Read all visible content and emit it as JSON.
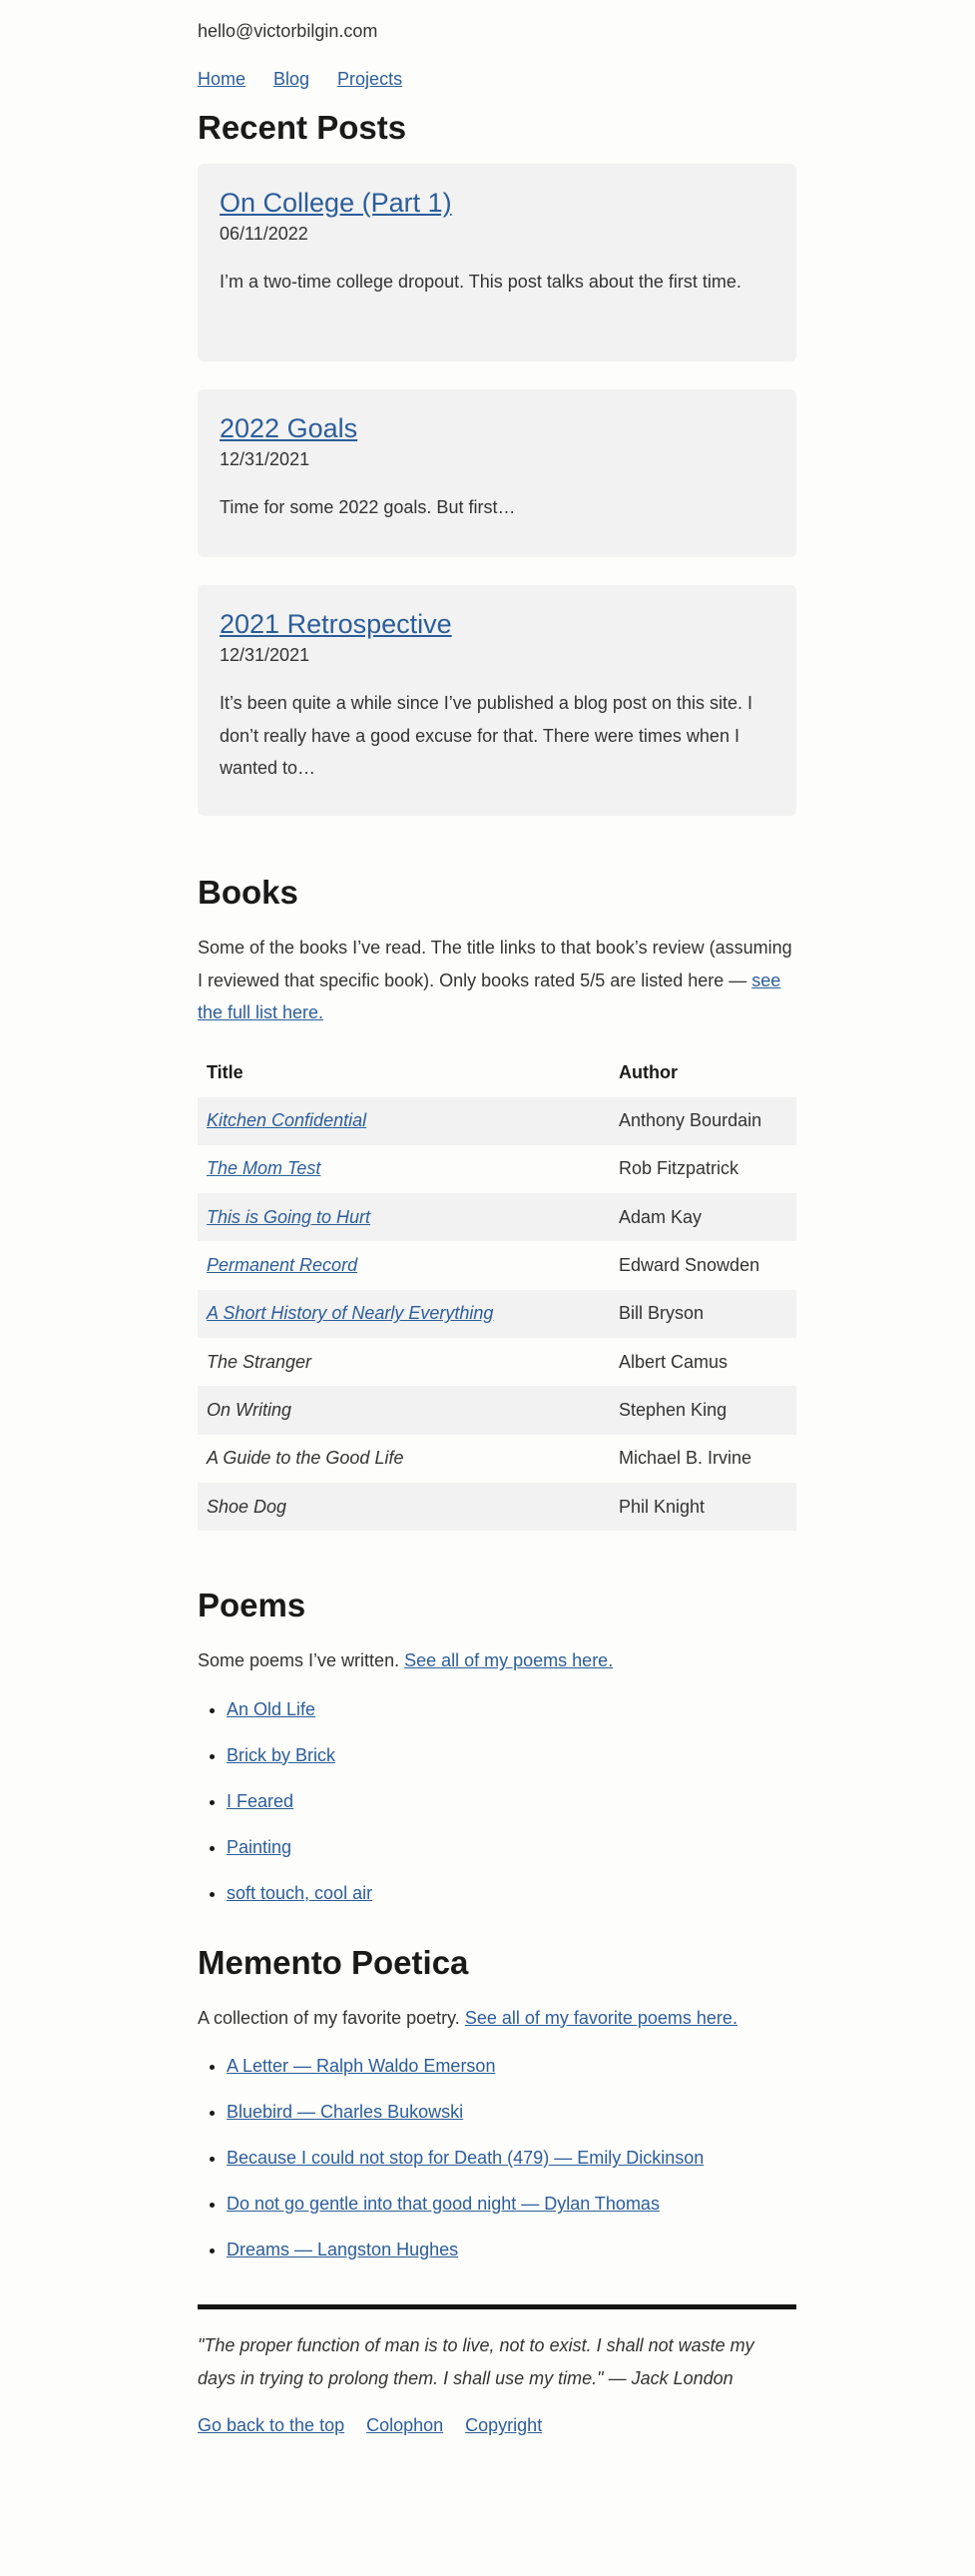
{
  "header": {
    "email": "hello@victorbilgin.com",
    "nav": [
      "Home",
      "Blog",
      "Projects"
    ]
  },
  "recent_posts": {
    "heading": "Recent Posts",
    "posts": [
      {
        "title": "On College (Part 1)",
        "date": "06/11/2022",
        "excerpt": "I’m a two-time college dropout. This post talks about the first time."
      },
      {
        "title": "2022 Goals",
        "date": "12/31/2021",
        "excerpt": "Time for some 2022 goals. But first…"
      },
      {
        "title": "2021 Retrospective",
        "date": "12/31/2021",
        "excerpt": "It’s been quite a while since I’ve published a blog post on this site. I don’t really have a good excuse for that. There were times when I wanted to…"
      }
    ]
  },
  "books": {
    "heading": "Books",
    "intro": "Some of the books I’ve read. The title links to that book’s review (assuming I reviewed that specific book). Only books rated 5/5 are listed here —",
    "intro_link": "see the full list here.",
    "columns": [
      "Title",
      "Author"
    ],
    "rows": [
      {
        "title": "Kitchen Confidential",
        "author": "Anthony Bourdain",
        "linked": true
      },
      {
        "title": "The Mom Test",
        "author": "Rob Fitzpatrick",
        "linked": true
      },
      {
        "title": "This is Going to Hurt",
        "author": "Adam Kay",
        "linked": true
      },
      {
        "title": "Permanent Record",
        "author": "Edward Snowden",
        "linked": true
      },
      {
        "title": "A Short History of Nearly Everything",
        "author": "Bill Bryson",
        "linked": true
      },
      {
        "title": "The Stranger",
        "author": "Albert Camus",
        "linked": false
      },
      {
        "title": "On Writing",
        "author": "Stephen King",
        "linked": false
      },
      {
        "title": "A Guide to the Good Life",
        "author": "Michael B. Irvine",
        "linked": false
      },
      {
        "title": "Shoe Dog",
        "author": "Phil Knight",
        "linked": false
      }
    ]
  },
  "poems": {
    "heading": "Poems",
    "intro": "Some poems I’ve written.",
    "intro_link": "See all of my poems here.",
    "items": [
      "An Old Life",
      "Brick by Brick",
      "I Feared",
      "Painting",
      "soft touch, cool air"
    ]
  },
  "memento": {
    "heading": "Memento Poetica",
    "intro": "A collection of my favorite poetry.",
    "intro_link": "See all of my favorite poems here.",
    "items": [
      "A Letter — Ralph Waldo Emerson",
      "Bluebird — Charles Bukowski",
      "Because I could not stop for Death (479) — Emily Dickinson",
      "Do not go gentle into that good night — Dylan Thomas",
      "Dreams — Langston Hughes"
    ]
  },
  "footer": {
    "quote": "\"The proper function of man is to live, not to exist. I shall not waste my days in trying to prolong them. I shall use my time.\" — Jack London",
    "links": [
      "Go back to the top",
      "Colophon",
      "Copyright"
    ]
  },
  "colors": {
    "link": "#2c5d99",
    "card": "#f2f2f2",
    "text": "#2b2b2b",
    "rule": "#141414"
  }
}
